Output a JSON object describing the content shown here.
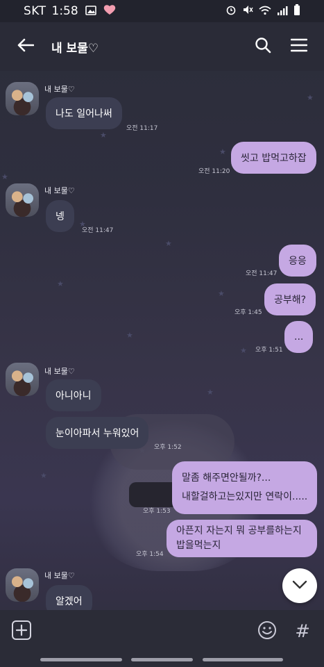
{
  "status_bar": {
    "carrier": "SKT",
    "time": "1:58"
  },
  "header": {
    "title": "내 보물♡"
  },
  "messages": {
    "m1": {
      "sender": "내 보물♡",
      "text": "나도 일어나써",
      "time": "오전 11:17"
    },
    "m2": {
      "text": "씻고 밥먹고하잡",
      "time": "오전 11:20"
    },
    "m3": {
      "sender": "내 보물♡",
      "text": "넹",
      "time": "오전 11:47"
    },
    "m4": {
      "text": "응응",
      "time": "오전 11:47"
    },
    "m5": {
      "text": "공부해?",
      "time": "오후 1:45"
    },
    "m6": {
      "text": "...",
      "time": "오후 1:51"
    },
    "m7": {
      "sender": "내 보물♡",
      "text": "아니아니"
    },
    "m8": {
      "text": "눈이아파서 누워있어",
      "time": "오후 1:52"
    },
    "m9": {
      "line1": "말좀 해주면안될까?...",
      "line2": "내할걸하고는있지만 연락이.....",
      "time": "오후 1:53"
    },
    "m10": {
      "line1": "아픈지 자는지 뭐 공부를하는지",
      "line2": "밥을먹는지",
      "time": "오후 1:54"
    },
    "m11": {
      "sender": "내 보물♡",
      "text": "알겠어"
    }
  },
  "icons": {
    "back": "arrow-left-icon",
    "search": "search-icon",
    "menu": "hamburger-menu-icon",
    "add": "plus-box-icon",
    "emoji": "emoji-icon",
    "hash": "hash-icon",
    "scroll": "chevron-down-icon"
  },
  "colors": {
    "outgoing_bubble": "#c5a8e3",
    "incoming_bubble": "#3c3e52",
    "header": "#2a2b37"
  }
}
